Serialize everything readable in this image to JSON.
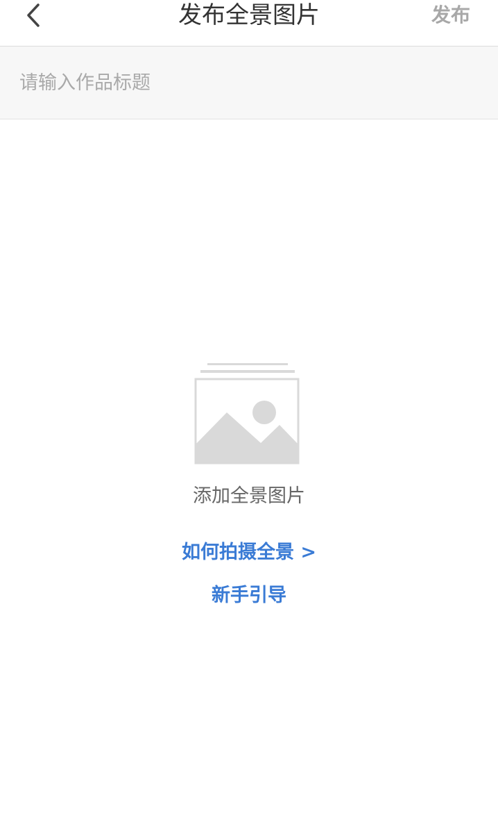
{
  "header": {
    "back_icon": "chevron-left-icon",
    "title": "发布全景图片",
    "publish_label": "发布"
  },
  "form": {
    "title_placeholder": "请输入作品标题",
    "title_value": ""
  },
  "upload": {
    "icon": "image-placeholder-icon",
    "label": "添加全景图片"
  },
  "links": {
    "how_to_shoot": "如何拍摄全景 >",
    "beginner_guide": "新手引导"
  },
  "colors": {
    "link": "#3a7bd5",
    "publish_disabled": "#a8a8a8",
    "placeholder_grey": "#d9d9d9",
    "input_bg": "#f7f7f7"
  }
}
